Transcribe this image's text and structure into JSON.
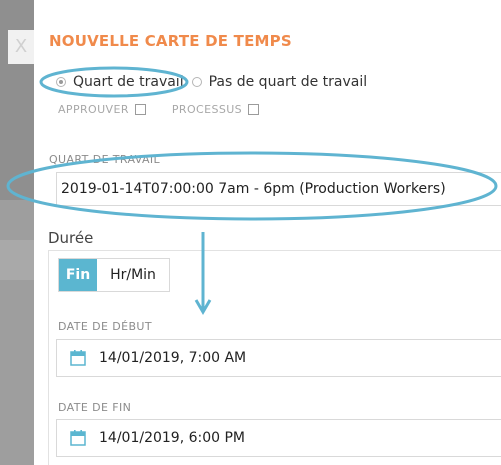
{
  "form": {
    "title": "NOUVELLE CARTE DE TEMPS",
    "close_label": "X",
    "radio_shift": "Quart de travail",
    "radio_no_shift": "Pas de quart de travail",
    "approve_label": "APPROUVER",
    "process_label": "PROCESSUS",
    "shift_label": "QUART DE TRAVAIL",
    "shift_value": "2019-01-14T07:00:00 7am - 6pm (Production Workers)",
    "duration_label": "Durée",
    "toggle_end": "Fin",
    "toggle_hrmin": "Hr/Min",
    "start_label": "DATE DE DÉBUT",
    "start_value": "14/01/2019, 7:00 AM",
    "end_label": "DATE DE FIN",
    "end_value": "14/01/2019, 6:00 PM"
  },
  "colors": {
    "accent_orange": "#f08a4b",
    "toggle_active": "#5bb6d0",
    "annotation_blue": "#5fb4d1"
  },
  "annotations": {
    "icons": [
      "ellipse-highlight",
      "arrow-down"
    ]
  }
}
